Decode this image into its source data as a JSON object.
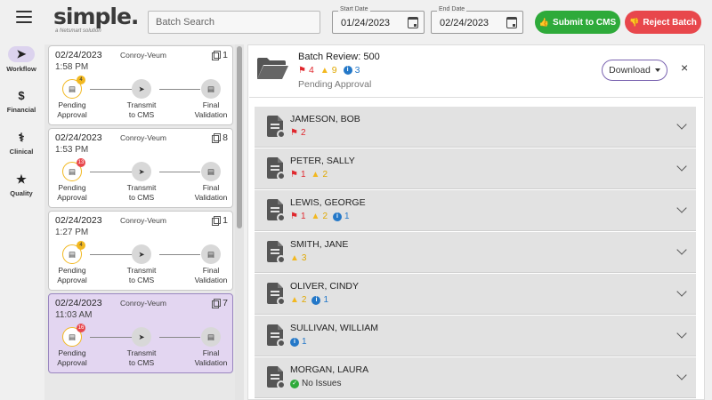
{
  "header": {
    "logo_word": "simple.",
    "logo_tagline": "a Netsmart solution",
    "search_placeholder": "Batch Search",
    "start_date_label": "Start Date",
    "start_date": "01/24/2023",
    "end_date_label": "End Date",
    "end_date": "02/24/2023",
    "submit_label": "Submit to CMS",
    "reject_label": "Reject Batch"
  },
  "nav": [
    {
      "label": "Workflow",
      "icon": "paper-plane-icon"
    },
    {
      "label": "Financial",
      "icon": "dollar-icon"
    },
    {
      "label": "Clinical",
      "icon": "stethoscope-icon"
    },
    {
      "label": "Quality",
      "icon": "star-icon"
    }
  ],
  "steps": {
    "s1": "Pending",
    "s1b": "Approval",
    "s2": "Transmit",
    "s2b": "to CMS",
    "s3": "Final",
    "s3b": "Validation"
  },
  "batches": [
    {
      "date": "02/24/2023",
      "time": "1:58 PM",
      "org": "Conroy-Veum",
      "count": "1",
      "badge": "4",
      "badge_color": "#f2b820"
    },
    {
      "date": "02/24/2023",
      "time": "1:53 PM",
      "org": "Conroy-Veum",
      "count": "8",
      "badge": "13",
      "badge_color": "#e8474c"
    },
    {
      "date": "02/24/2023",
      "time": "1:27 PM",
      "org": "Conroy-Veum",
      "count": "1",
      "badge": "4",
      "badge_color": "#f2b820"
    },
    {
      "date": "02/24/2023",
      "time": "11:03 AM",
      "org": "Conroy-Veum",
      "count": "7",
      "badge": "16",
      "badge_color": "#e8474c"
    }
  ],
  "review": {
    "title": "Batch Review: 500",
    "flags": "4",
    "warnings": "9",
    "info": "3",
    "status": "Pending Approval",
    "download_label": "Download",
    "close_glyph": "×"
  },
  "patients": [
    {
      "name": "JAMESON, BOB",
      "flags": "2"
    },
    {
      "name": "PETER, SALLY",
      "flags": "1",
      "warnings": "2"
    },
    {
      "name": "LEWIS, GEORGE",
      "flags": "1",
      "warnings": "2",
      "info": "1"
    },
    {
      "name": "SMITH, JANE",
      "warnings": "3"
    },
    {
      "name": "OLIVER, CINDY",
      "warnings": "2",
      "info": "1"
    },
    {
      "name": "SULLIVAN, WILLIAM",
      "info": "1"
    },
    {
      "name": "MORGAN, LAURA",
      "ok": "No Issues"
    }
  ],
  "colors": {
    "accent": "#7a63b0",
    "green": "#2eaa3a",
    "red": "#e8474c",
    "yellow": "#f2b820",
    "blue": "#2478c8"
  }
}
